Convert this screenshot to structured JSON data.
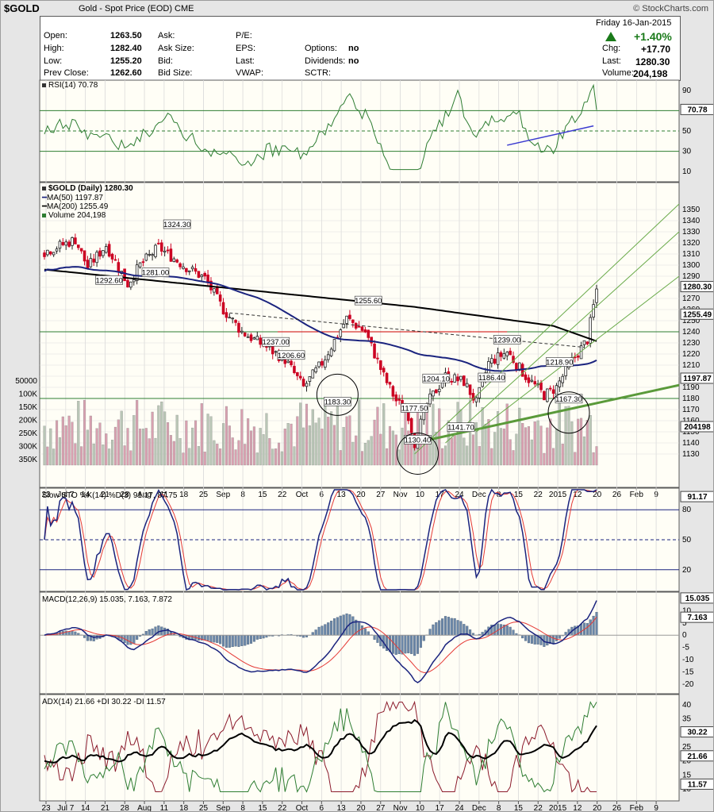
{
  "header": {
    "symbol": "$GOLD",
    "name": "Gold - Spot Price (EOD)",
    "exchange": "CME",
    "source": "© StockCharts.com"
  },
  "quote": {
    "date_line": "Friday  16-Jan-2015",
    "labels": {
      "open": "Open:",
      "high": "High:",
      "low": "Low:",
      "prev": "Prev Close:",
      "ask": "Ask:",
      "asksize": "Ask Size:",
      "bid": "Bid:",
      "bidsize": "Bid Size:",
      "pe": "P/E:",
      "eps": "EPS:",
      "last_l": "Last:",
      "vwap": "VWAP:",
      "options": "Options:",
      "dividends": "Dividends:",
      "sctr": "SCTR:",
      "chg": "Chg:",
      "last": "Last:",
      "volume": "Volume:"
    },
    "open": "1263.50",
    "high": "1282.40",
    "low": "1255.20",
    "prev_close": "1262.60",
    "options": "no",
    "dividends": "no",
    "pct_change": "+1.40%",
    "chg": "+17.70",
    "last": "1280.30",
    "volume": "204,198",
    "up_color": "#1a7a1a"
  },
  "rsi": {
    "label": "RSI(14) 70.78",
    "current": "70.78",
    "ticks": [
      "90",
      "70",
      "50",
      "30",
      "10"
    ]
  },
  "price": {
    "legend": {
      "title": "$GOLD (Daily) 1280.30",
      "ma50": "MA(50) 1197.87",
      "ma200": "MA(200) 1255.49",
      "volume": "Volume 204,198"
    },
    "ticks": [
      "1350",
      "1340",
      "1330",
      "1320",
      "1310",
      "1300",
      "1290",
      "1280",
      "1270",
      "1260",
      "1250",
      "1240",
      "1230",
      "1220",
      "1210",
      "1200",
      "1190",
      "1180",
      "1170",
      "1160",
      "1150",
      "1140",
      "1130"
    ],
    "last_tag": "1280.30",
    "ma200_tag": "1255.49",
    "ma50_tag": "1197.87",
    "vol_tag": "204198",
    "vol_ticks": [
      "350K",
      "300K",
      "250K",
      "200K",
      "150K",
      "100K",
      "50000"
    ],
    "annotations": [
      "1324.30",
      "1292.60",
      "1281.00",
      "1237.00",
      "1206.60",
      "1183.30",
      "1255.60",
      "1177.50",
      "1130.40",
      "1204.10",
      "1186.40",
      "1239.00",
      "1141.70",
      "1218.90",
      "1167.30"
    ]
  },
  "sto": {
    "label": "Slow STO %K(14) %D(3) 91.17, 87.75",
    "k_tag": "91.17",
    "d_tag": "87.75",
    "ticks": [
      "80",
      "50",
      "20"
    ]
  },
  "macd": {
    "label": "MACD(12,26,9) 15.035, 7.163, 7.872",
    "macd_tag": "15.035",
    "signal_tag": "7.163",
    "ticks": [
      "10",
      "5",
      "0",
      "-5",
      "-10",
      "-15",
      "-20"
    ]
  },
  "adx": {
    "label": "ADX(14) 21.66 +DI 30.22 -DI 11.57",
    "adx_tag": "21.66",
    "pdi_tag": "30.22",
    "mdi_tag": "11.57",
    "ticks": [
      "40",
      "35",
      "30",
      "25",
      "20",
      "15",
      "10"
    ]
  },
  "x_axis": [
    "23",
    "Jul 7",
    "14",
    "21",
    "28",
    "Aug",
    "11",
    "18",
    "25",
    "Sep",
    "8",
    "15",
    "22",
    "Oct",
    "6",
    "13",
    "20",
    "27",
    "Nov",
    "10",
    "17",
    "24",
    "Dec",
    "8",
    "15",
    "22",
    "2015",
    "12",
    "20",
    "26",
    "Feb",
    "9"
  ],
  "colors": {
    "up": "#7f7f7f",
    "down": "#cc0022",
    "ma50": "#1a237e",
    "ma200": "#000000",
    "green": "#2e7d32",
    "red": "#cc0000"
  },
  "chart_data": {
    "type": "candlestick",
    "title": "$GOLD (Daily) 1280.30",
    "ylim": [
      1120,
      1360
    ],
    "key_levels": [
      {
        "name": "resistance",
        "value": 1240
      },
      {
        "name": "support",
        "value": 1180
      }
    ],
    "swing_points": [
      {
        "date": "Jul 10",
        "value": 1324.3
      },
      {
        "date": "Jul 10",
        "value": 1292.6
      },
      {
        "date": "Jul 31",
        "value": 1281.0
      },
      {
        "date": "Sep 24",
        "value": 1237.0
      },
      {
        "date": "Sep 26",
        "value": 1206.6
      },
      {
        "date": "Oct 6",
        "value": 1183.3
      },
      {
        "date": "Oct 21",
        "value": 1255.6
      },
      {
        "date": "Nov 4",
        "value": 1177.5
      },
      {
        "date": "Nov 7",
        "value": 1130.4
      },
      {
        "date": "Nov 21",
        "value": 1204.1
      },
      {
        "date": "Dec 1",
        "value": 1186.4
      },
      {
        "date": "Dec 9",
        "value": 1239.0
      },
      {
        "date": "Dec 1",
        "value": 1141.7
      },
      {
        "date": "Dec 29",
        "value": 1218.9
      },
      {
        "date": "Dec 31",
        "value": 1167.3
      }
    ],
    "last": 1280.3,
    "ma50": 1197.87,
    "ma200": 1255.49,
    "volume": 204198
  }
}
